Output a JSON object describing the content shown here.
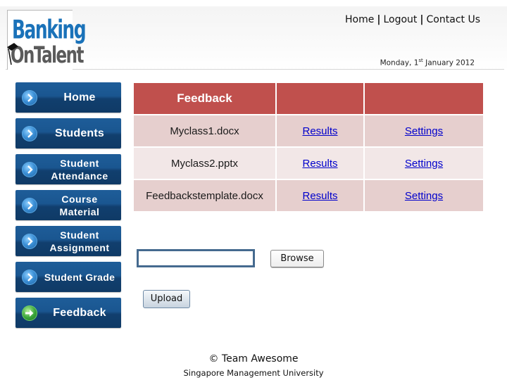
{
  "header": {
    "logo_line1": "Banking",
    "logo_line2": "OnTalent",
    "top_nav": [
      {
        "label": "Home"
      },
      {
        "label": "Logout"
      },
      {
        "label": "Contact Us"
      }
    ],
    "separator": "|",
    "date": {
      "prefix": "Monday, 1",
      "suffix_sup": "st",
      "rest": " January 2012"
    }
  },
  "sidebar": {
    "items": [
      {
        "label": "Home",
        "icon": "chevron-right-icon"
      },
      {
        "label": "Students",
        "icon": "chevron-right-icon"
      },
      {
        "label": "Student Attendance",
        "icon": "chevron-right-icon"
      },
      {
        "label": "Course Material",
        "icon": "chevron-right-icon"
      },
      {
        "label": "Student Assignment",
        "icon": "chevron-right-icon"
      },
      {
        "label": "Student Grade",
        "icon": "chevron-right-icon"
      },
      {
        "label": "Feedback",
        "icon": "arrow-right-icon",
        "active": true
      }
    ]
  },
  "feedback_table": {
    "headers": [
      "Feedback",
      "",
      ""
    ],
    "rows": [
      {
        "file": "Myclass1.docx",
        "results": "Results",
        "settings": "Settings"
      },
      {
        "file": "Myclass2.pptx",
        "results": "Results",
        "settings": "Settings"
      },
      {
        "file": "Feedbackstemplate.docx",
        "results": "Results",
        "settings": "Settings"
      }
    ],
    "colors": {
      "header": "#c0504d",
      "row_dark": "#e6cfce",
      "row_light": "#f2e7e7",
      "link": "#0000cc"
    }
  },
  "upload": {
    "file_value": "",
    "browse_label": "Browse",
    "upload_label": "Upload"
  },
  "footer": {
    "copyright": "© Team Awesome",
    "institution": "Singapore Management University"
  }
}
